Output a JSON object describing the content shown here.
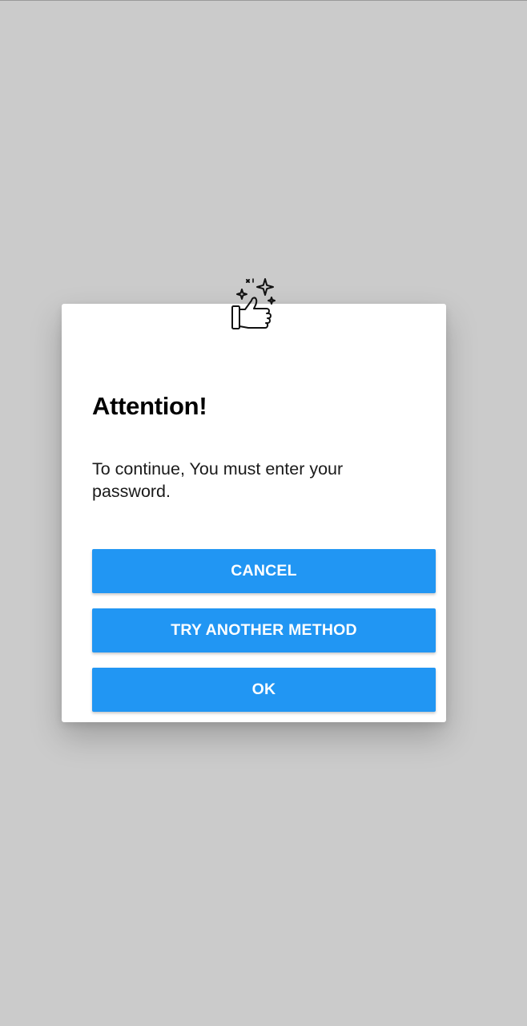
{
  "dialog": {
    "icon": "thumbs-up-sparkle-icon",
    "title": "Attention!",
    "message": "To continue, You must enter your password.",
    "buttons": {
      "cancel": "CANCEL",
      "try_another": "TRY ANOTHER METHOD",
      "ok": "OK"
    }
  },
  "colors": {
    "backdrop": "#cbcbcb",
    "dialog_background": "#ffffff",
    "button": "#2196f3",
    "button_text": "#ffffff"
  }
}
